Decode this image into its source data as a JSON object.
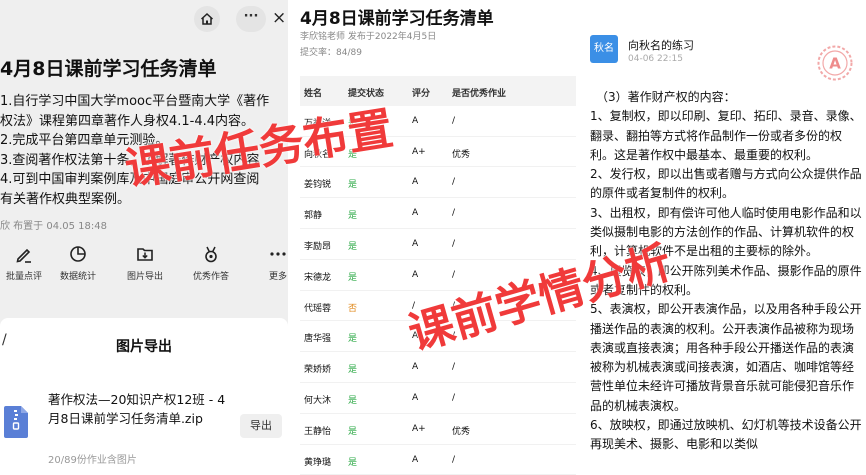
{
  "left": {
    "more_label": "···",
    "close_label": "×",
    "task_title": "4月8日课前学习任务清单",
    "task_items": [
      "1.自行学习中国大学mooc平台暨南大学《著作",
      "权法》课程第四章著作人身权4.1-4.4内容。",
      "2.完成平台第四章单元测验。",
      "3.查阅著作权法第十条，了解著作财产权内容",
      "4.可到中国审判案例库及中国庭审公开网查阅",
      "有关著作权典型案例。"
    ],
    "task_meta": "欣 布置于 04.05 18:48",
    "actions": [
      "批量点评",
      "数据统计",
      "图片导出",
      "优秀作答",
      "更多"
    ],
    "sheet_close": "/",
    "sheet_title": "图片导出",
    "file_name": "著作权法—20知识产权12班 - 4月8日课前学习任务清单.zip",
    "file_sub": "20/89份作业含图片",
    "export_label": "导出"
  },
  "middle": {
    "title": "4月8日课前学习任务清单",
    "author": "李欣铭老师 发布于2022年4月5日",
    "rate_label": "提交率：",
    "rate_value": "84/89",
    "headers": [
      "姓名",
      "提交状态",
      "评分",
      "是否优秀作业"
    ],
    "rows": [
      {
        "name": "万祖洋",
        "status": "是",
        "score": "A",
        "excellent": "/"
      },
      {
        "name": "向秋名",
        "status": "是",
        "score": "A+",
        "excellent": "优秀"
      },
      {
        "name": "姜钧锐",
        "status": "是",
        "score": "A",
        "excellent": "/"
      },
      {
        "name": "郭静",
        "status": "是",
        "score": "A",
        "excellent": "/"
      },
      {
        "name": "李励昂",
        "status": "是",
        "score": "A",
        "excellent": "/"
      },
      {
        "name": "宋德龙",
        "status": "是",
        "score": "A",
        "excellent": "/"
      },
      {
        "name": "代瑶蓉",
        "status": "否",
        "score": "/",
        "excellent": "/"
      },
      {
        "name": "唐华强",
        "status": "是",
        "score": "A",
        "excellent": "/"
      },
      {
        "name": "荣娇娇",
        "status": "是",
        "score": "A",
        "excellent": "/"
      },
      {
        "name": "何大沐",
        "status": "是",
        "score": "A",
        "excellent": "/"
      },
      {
        "name": "王静怡",
        "status": "是",
        "score": "A+",
        "excellent": "优秀"
      },
      {
        "name": "黄琤璐",
        "status": "是",
        "score": "A",
        "excellent": "/"
      }
    ]
  },
  "right": {
    "avatar_text": "秋名",
    "name": "向秋名的练习",
    "time": "04-06 22:15",
    "stamp_text": "A",
    "heading": "（3）著作财产权的内容：",
    "paragraphs": [
      "1、复制权，即以印刷、复印、拓印、录音、录像、翻录、翻拍等方式将作品制作一份或者多份的权利。这是著作权中最基本、最重要的权利。",
      "2、发行权，即以出售或者赠与方式向公众提供作品的原件或者复制件的权利。",
      "3、出租权，即有偿许可他人临时使用电影作品和以类似摄制电影的方法创作的作品、计算机软件的权利，计算机软件不是出租的主要标的除外。",
      "4、展览权，即公开陈列美术作品、摄影作品的原件或者复制件的权利。",
      "5、表演权，即公开表演作品，以及用各种手段公开播送作品的表演的权利。公开表演作品被称为现场表演或直接表演；用各种手段公开播送作品的表演被称为机械表演或间接表演，如酒店、咖啡馆等经营性单位未经许可播放背景音乐就可能侵犯音乐作品的机械表演权。",
      "6、放映权，即通过放映机、幻灯机等技术设备公开再现美术、摄影、电影和以类似"
    ]
  },
  "overlay": {
    "label1": "课前任务布置",
    "label2": "课前学情分析"
  },
  "colors": {
    "overlay_red": "#f03a3a",
    "yes_green": "#2aa844",
    "no_orange": "#e08a1e",
    "avatar_blue": "#3b8fe6"
  }
}
